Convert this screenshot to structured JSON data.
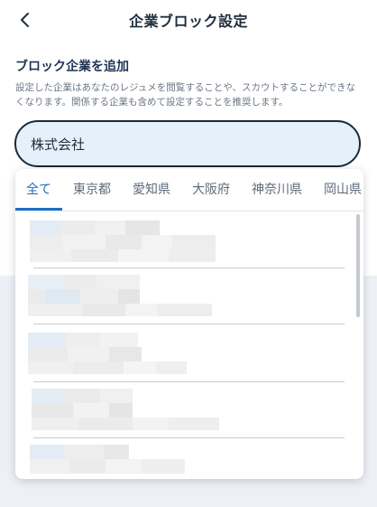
{
  "header": {
    "title": "企業ブロック設定",
    "back_icon": "chevron-left-icon"
  },
  "section": {
    "title": "ブロック企業を追加",
    "description": "設定した企業はあなたのレジュメを閲覧することや、スカウトすることができなくなります。関係する企業も含めて設定することを推奨します。"
  },
  "search": {
    "value": "株式会社"
  },
  "dropdown": {
    "tabs": [
      {
        "label": "全て",
        "active": true
      },
      {
        "label": "東京都",
        "active": false
      },
      {
        "label": "愛知県",
        "active": false
      },
      {
        "label": "大阪府",
        "active": false
      },
      {
        "label": "神奈川県",
        "active": false
      },
      {
        "label": "岡山県",
        "active": false
      }
    ],
    "results_blurred": true
  },
  "colors": {
    "accent": "#1c6fc4",
    "search_bg": "#e6f0fa",
    "background": "#edf1f6"
  }
}
